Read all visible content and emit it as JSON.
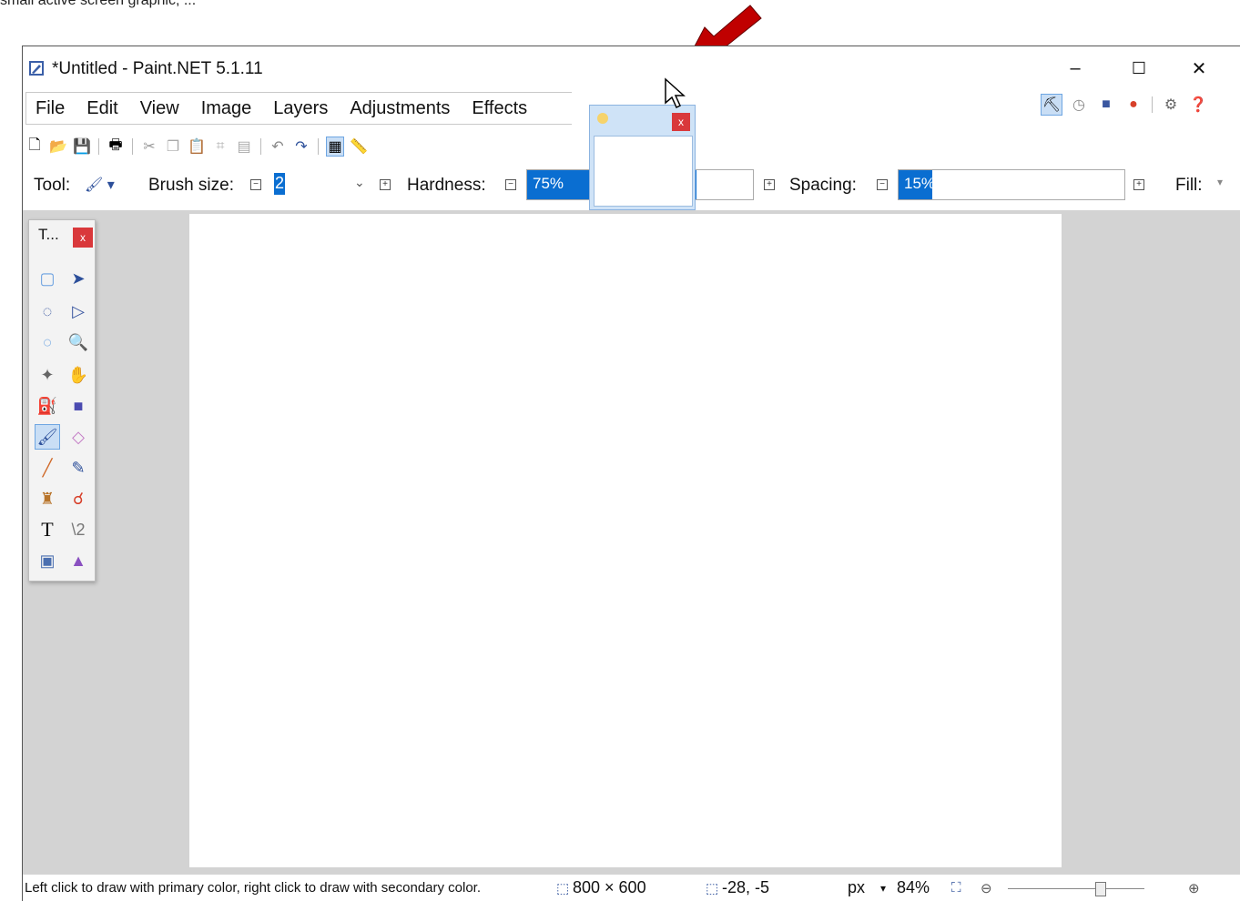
{
  "caption": "small active screen graphic, ...",
  "window": {
    "title": "*Untitled - Paint.NET 5.1.11",
    "minimize": "–",
    "maximize": "☐",
    "close": "✕"
  },
  "menu": {
    "items": [
      "File",
      "Edit",
      "View",
      "Image",
      "Layers",
      "Adjustments",
      "Effects"
    ]
  },
  "options": {
    "tool_label": "Tool:",
    "brush_size_label": "Brush size:",
    "brush_size_value": "2",
    "hardness_label": "Hardness:",
    "hardness_value": "75%",
    "hardness_fraction": 0.75,
    "spacing_label": "Spacing:",
    "spacing_value": "15%",
    "spacing_fraction": 0.15,
    "fill_label": "Fill:"
  },
  "palette": {
    "title": "T...",
    "close": "x"
  },
  "status": {
    "hint": "Left click to draw with primary color, right click to draw with secondary color.",
    "image_size": "800 × 600",
    "cursor_pos": "-28, -5",
    "units": "px",
    "zoom": "84%"
  },
  "floater": {
    "close": "x"
  }
}
